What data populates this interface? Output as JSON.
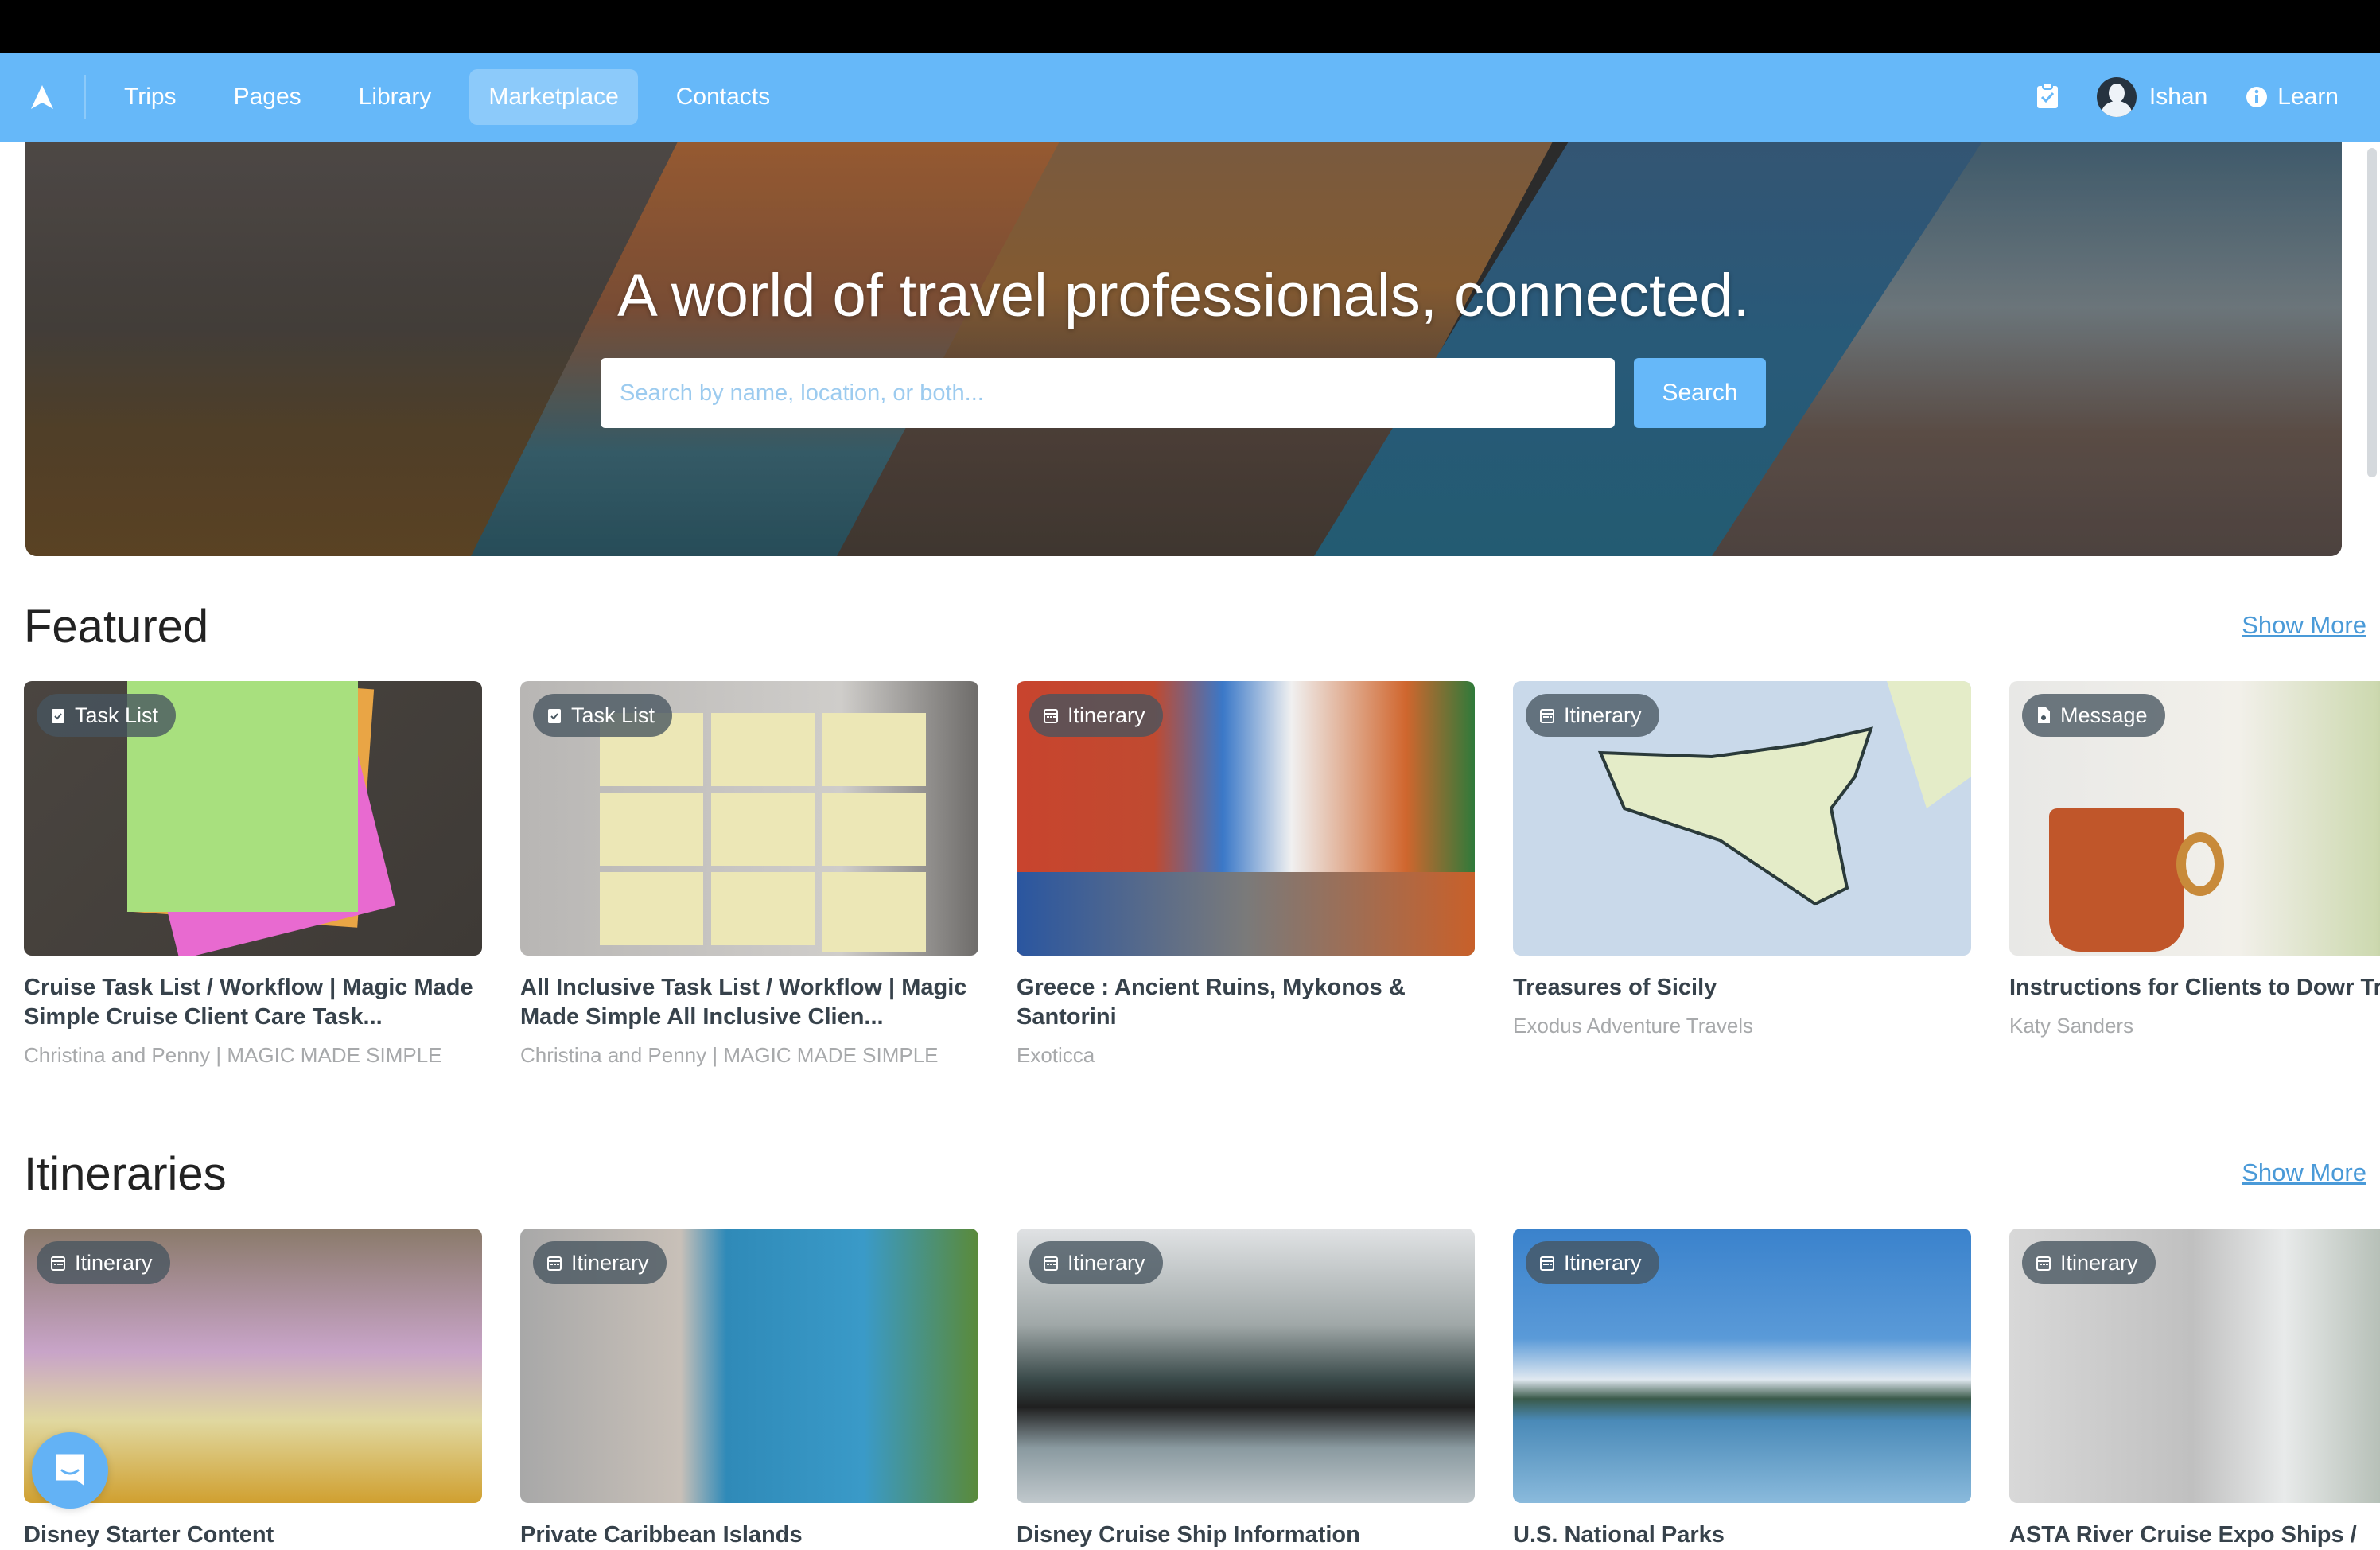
{
  "nav": {
    "logo": "app-logo",
    "items": [
      {
        "label": "Trips",
        "active": false
      },
      {
        "label": "Pages",
        "active": false
      },
      {
        "label": "Library",
        "active": false
      },
      {
        "label": "Marketplace",
        "active": true
      },
      {
        "label": "Contacts",
        "active": false
      }
    ],
    "user_name": "Ishan",
    "learn_label": "Learn",
    "accent_color": "#66b8f9"
  },
  "hero": {
    "headline": "A world of travel professionals, connected.",
    "search_placeholder": "Search by name, location, or both...",
    "search_value": "",
    "search_button": "Search"
  },
  "featured": {
    "title": "Featured",
    "show_more": "Show More",
    "cards": [
      {
        "badge": "Task List",
        "badge_icon": "clipboard-check-icon",
        "title": "Cruise Task List / Workflow | Magic Made Simple Cruise Client Care Task...",
        "subtitle": "Christina and Penny | MAGIC MADE SIMPLE"
      },
      {
        "badge": "Task List",
        "badge_icon": "clipboard-check-icon",
        "title": "All Inclusive Task List / Workflow | Magic Made Simple All Inclusive Clien...",
        "subtitle": "Christina and Penny | MAGIC MADE SIMPLE"
      },
      {
        "badge": "Itinerary",
        "badge_icon": "calendar-icon",
        "title": "Greece : Ancient Ruins, Mykonos & Santorini",
        "subtitle": "Exoticca"
      },
      {
        "badge": "Itinerary",
        "badge_icon": "calendar-icon",
        "title": "Treasures of Sicily",
        "subtitle": "Exodus Adventure Travels"
      },
      {
        "badge": "Message",
        "badge_icon": "document-icon",
        "title": "Instructions for Clients to Dowr Trip Plans App (Message)",
        "subtitle": "Katy Sanders"
      }
    ]
  },
  "itineraries": {
    "title": "Itineraries",
    "show_more": "Show More",
    "cards": [
      {
        "badge": "Itinerary",
        "badge_icon": "calendar-icon",
        "title": "Disney Starter Content"
      },
      {
        "badge": "Itinerary",
        "badge_icon": "calendar-icon",
        "title": "Private Caribbean Islands"
      },
      {
        "badge": "Itinerary",
        "badge_icon": "calendar-icon",
        "title": "Disney Cruise Ship Information"
      },
      {
        "badge": "Itinerary",
        "badge_icon": "calendar-icon",
        "title": "U.S. National Parks"
      },
      {
        "badge": "Itinerary",
        "badge_icon": "calendar-icon",
        "title": "ASTA River Cruise Expo Ships /"
      }
    ]
  },
  "chat": {
    "icon": "chat-bubble-icon"
  }
}
